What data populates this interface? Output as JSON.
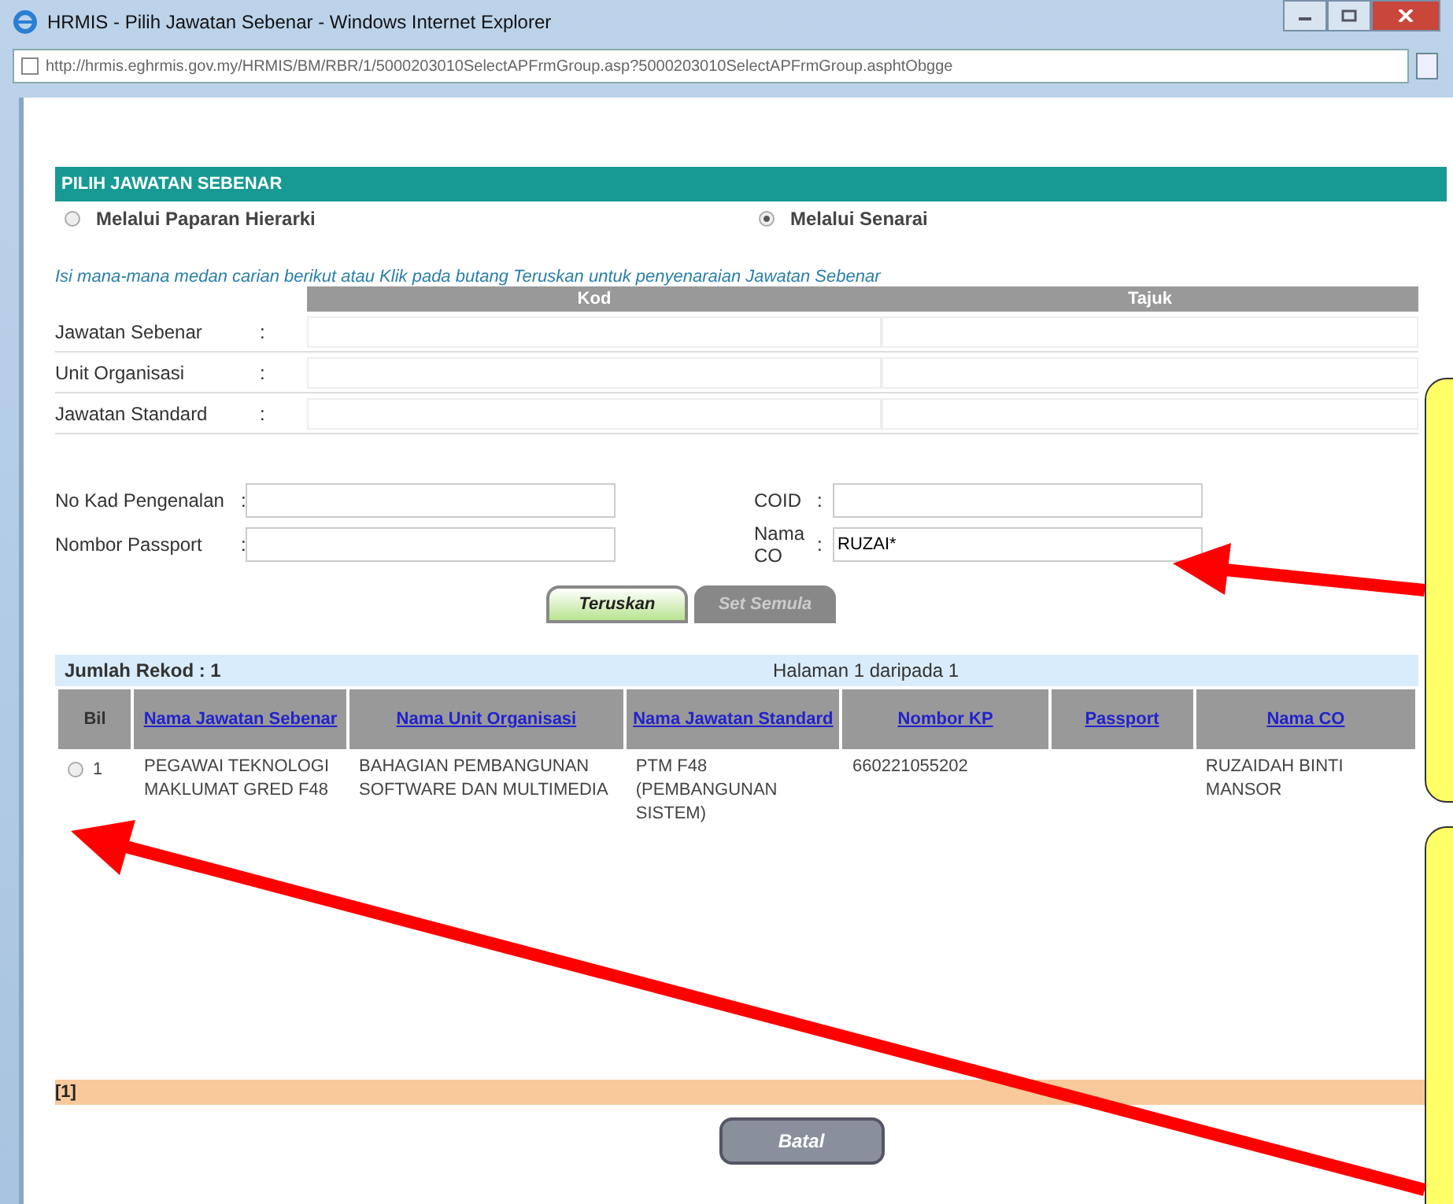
{
  "window": {
    "title": "HRMIS - Pilih Jawatan Sebenar - Windows Internet Explorer"
  },
  "address_bar": {
    "url": "http://hrmis.eghrmis.gov.my/HRMIS/BM/RBR/1/5000203010SelectAPFrmGroup.asp?5000203010SelectAPFrmGroup.asphtObgge"
  },
  "section": {
    "title": "PILIH JAWATAN SEBENAR"
  },
  "view_options": [
    {
      "label": "Melalui Paparan Hierarki",
      "selected": false
    },
    {
      "label": "Melalui Senarai",
      "selected": true
    }
  ],
  "instruction": "Isi mana-mana medan carian berikut atau Klik pada butang Teruskan untuk penyenaraian Jawatan Sebenar",
  "search_table": {
    "columns": [
      "Kod",
      "Tajuk"
    ],
    "rows": [
      {
        "label": "Jawatan Sebenar",
        "separator": ":"
      },
      {
        "label": "Unit Organisasi",
        "separator": ":"
      },
      {
        "label": "Jawatan Standard",
        "separator": ":"
      }
    ]
  },
  "fields_left": [
    {
      "label": "No Kad Pengenalan",
      "separator": ":"
    },
    {
      "label": "Nombor Passport",
      "separator": ":"
    }
  ],
  "fields_right": [
    {
      "label": "COID",
      "separator": ":"
    },
    {
      "label": "Nama CO",
      "separator": ":",
      "value": "RUZAI*"
    }
  ],
  "buttons": [
    {
      "label": "Teruskan",
      "disabled": false
    },
    {
      "label": "Set Semula",
      "disabled": true
    }
  ],
  "summary": {
    "records": "Jumlah Rekod : 1",
    "page": "Halaman 1 daripada 1"
  },
  "results": {
    "columns": [
      {
        "label": "Bil",
        "link": false
      },
      {
        "label": "Nama Jawatan Sebenar",
        "link": true
      },
      {
        "label": "Nama Unit Organisasi",
        "link": true
      },
      {
        "label": "Nama Jawatan Standard",
        "link": true
      },
      {
        "label": "Nombor KP",
        "link": true
      },
      {
        "label": "Passport",
        "link": true
      },
      {
        "label": "Nama CO",
        "link": true
      }
    ],
    "rows": [
      {
        "selected": false,
        "bil": "1",
        "jawatan_sebenar": "PEGAWAI TEKNOLOGI MAKLUMAT GRED F48",
        "unit": "BAHAGIAN PEMBANGUNAN SOFTWARE DAN MULTIMEDIA",
        "jawatan_standard": "PTM F48 (PEMBANGUNAN SISTEM)",
        "nombor_kp": "660221055202",
        "nama_co": "RUZAIDAH BINTI MANSOR"
      }
    ]
  },
  "pager": "[1]",
  "cancel_button": "Batal"
}
